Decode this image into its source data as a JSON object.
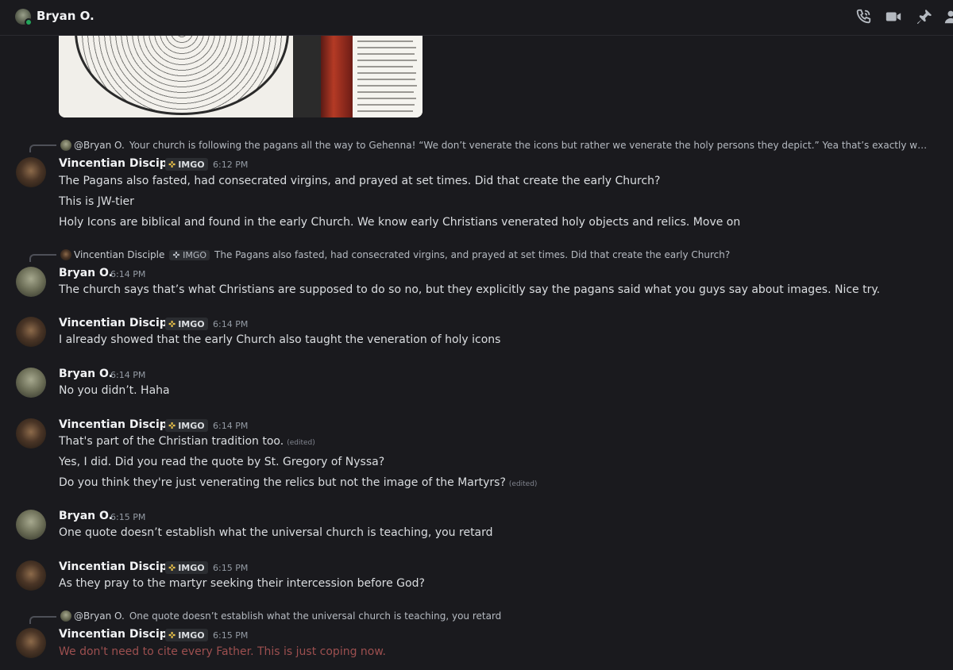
{
  "header": {
    "title": "Bryan O.",
    "icons": [
      "phone-call-icon",
      "video-camera-icon",
      "pin-icon",
      "add-member-icon"
    ]
  },
  "messages": [
    {
      "reply": {
        "name": "@Bryan O.",
        "text": "Your church is following the pagans all the way to Gehenna! “We don’t venerate the icons but rather we venerate the holy persons they depict.” Yea that’s exactly what the c…"
      },
      "author": "Vincentian Disciple",
      "badge": "IMGO",
      "time": "6:12 PM",
      "lines": [
        "The Pagans also fasted, had consecrated virgins, and prayed at set times. Did that create the early Church?",
        "This is JW-tier",
        "Holy Icons are biblical and found in the early Church. We know early Christians venerated holy objects and relics. Move on"
      ]
    },
    {
      "reply": {
        "name": "Vincentian Disciple",
        "badge": "IMGO",
        "text": "The Pagans also fasted, had consecrated virgins, and prayed at set times. Did that create the early Church?"
      },
      "author": "Bryan O.",
      "time": "6:14 PM",
      "lines": [
        "The church says that’s what Christians are supposed to do so no, but they explicitly say the pagans said what you guys say about images. Nice try."
      ]
    },
    {
      "author": "Vincentian Disciple",
      "badge": "IMGO",
      "time": "6:14 PM",
      "lines": [
        "I already showed that the early Church also taught the veneration of holy icons"
      ]
    },
    {
      "author": "Bryan O.",
      "time": "6:14 PM",
      "lines": [
        "No you didn’t. Haha"
      ]
    },
    {
      "author": "Vincentian Disciple",
      "badge": "IMGO",
      "time": "6:14 PM",
      "lines": [
        "That's part of the Christian tradition too.",
        "Yes, I did. Did you read the quote by St. Gregory of Nyssa?",
        "Do you think they're just venerating the relics but not the image of the Martyrs?"
      ],
      "edited_label": "(edited)"
    },
    {
      "author": "Bryan O.",
      "time": "6:15 PM",
      "lines": [
        "One quote doesn’t establish what the universal church is teaching, you retard"
      ]
    },
    {
      "author": "Vincentian Disciple",
      "badge": "IMGO",
      "time": "6:15 PM",
      "lines": [
        "As they pray to the martyr seeking their intercession before God?"
      ]
    },
    {
      "reply": {
        "name": "@Bryan O.",
        "text": "One quote doesn’t establish what the universal church is teaching, you retard"
      },
      "author": "Vincentian Disciple",
      "badge": "IMGO",
      "time": "6:15 PM",
      "lines": [
        "We don't need to cite every Father. This is just coping now."
      ]
    }
  ]
}
